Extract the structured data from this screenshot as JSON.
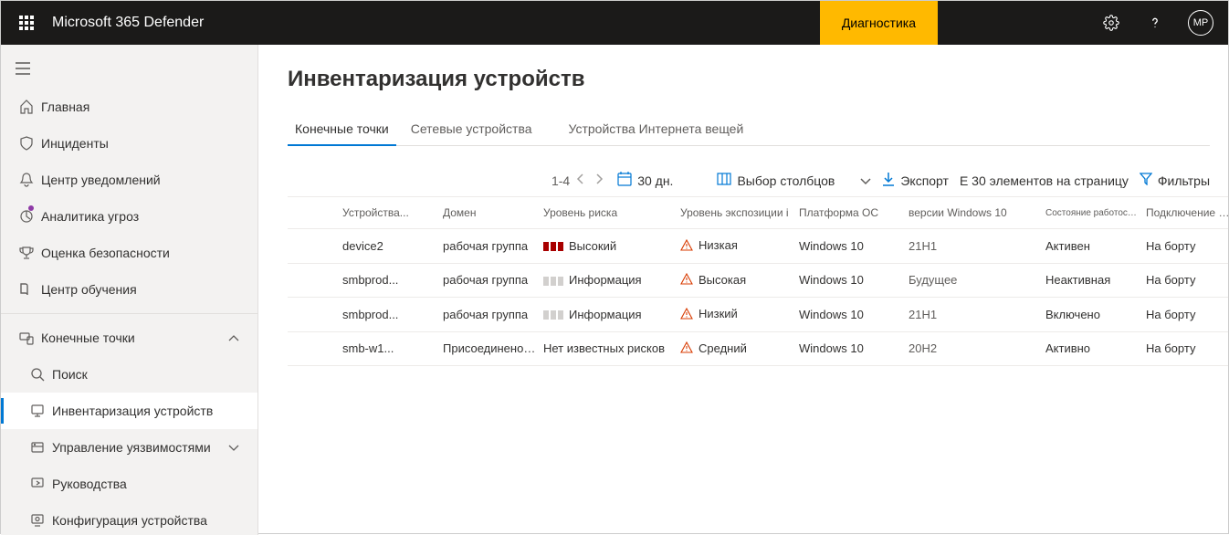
{
  "header": {
    "app_title": "Microsoft 365 Defender",
    "diagnostics": "Диагностика",
    "avatar_initials": "MP"
  },
  "sidebar": {
    "items": [
      {
        "icon": "home",
        "label": "Главная"
      },
      {
        "icon": "shield",
        "label": "Инциденты"
      },
      {
        "icon": "bell",
        "label": "Центр уведомлений"
      },
      {
        "icon": "analytics",
        "label": "Аналитика угроз",
        "dot": true
      },
      {
        "icon": "trophy",
        "label": "Оценка безопасности"
      },
      {
        "icon": "book",
        "label": "Центр обучения"
      },
      {
        "sep": true
      },
      {
        "icon": "endpoints",
        "label": "Конечные точки",
        "chev": "up"
      },
      {
        "icon": "search",
        "label": "Поиск",
        "sub": true
      },
      {
        "icon": "devices",
        "label": "Инвентаризация устройств",
        "sub": true,
        "selected": true
      },
      {
        "icon": "vuln",
        "label": "Управление уязвимостями",
        "sub": true,
        "chev": "down"
      },
      {
        "icon": "guide",
        "label": "Руководства",
        "sub": true
      },
      {
        "icon": "config",
        "label": "Конфигурация устройства",
        "sub": true
      }
    ]
  },
  "page": {
    "title": "Инвентаризация устройств",
    "tabs": [
      "Конечные точки",
      "Сетевые устройства",
      "Устройства Интернета вещей"
    ],
    "active_tab": 0,
    "toolbar": {
      "page_range": "1-4",
      "days": "30 дн.",
      "columns": "Выбор столбцов",
      "export": "Экспорт",
      "per_page": "E 30 элементов на страницу",
      "filters": "Фильтры"
    },
    "columns": [
      "Устройства...",
      "Домен",
      "Уровень риска",
      "Уровень экспозиции і",
      "Платформа ОС",
      "версии Windows 10",
      "Состояние работоспособности",
      "Подключение сб"
    ],
    "rows": [
      {
        "name": "device2",
        "domain": "рабочая группа",
        "risk_level": "Высокий",
        "risk_bars": "high",
        "exposure": "Низкая",
        "platform": "Windows 10",
        "version": "21H1",
        "health": "Активен",
        "connect": "На борту"
      },
      {
        "name": "smbprod...",
        "domain": "рабочая группа",
        "risk_level": "Информация",
        "risk_bars": "none",
        "exposure": "Высокая",
        "platform": "Windows 10",
        "version": "Будущее",
        "health": "Неактивная",
        "connect": "На борту"
      },
      {
        "name": "smbprod...",
        "domain": "рабочая группа",
        "risk_level": "Информация",
        "risk_bars": "none",
        "exposure": "Низкий",
        "platform": "Windows 10",
        "version": "21H1",
        "health": "Включено",
        "connect": "На борту"
      },
      {
        "name": "smb-w1...",
        "domain": "Присоединено к AAD",
        "risk_level": "Нет известных рисков",
        "risk_bars": "textonly",
        "exposure": "Средний",
        "platform": "Windows 10",
        "version": "20H2",
        "health": "Активно",
        "connect": "На борту"
      }
    ]
  }
}
